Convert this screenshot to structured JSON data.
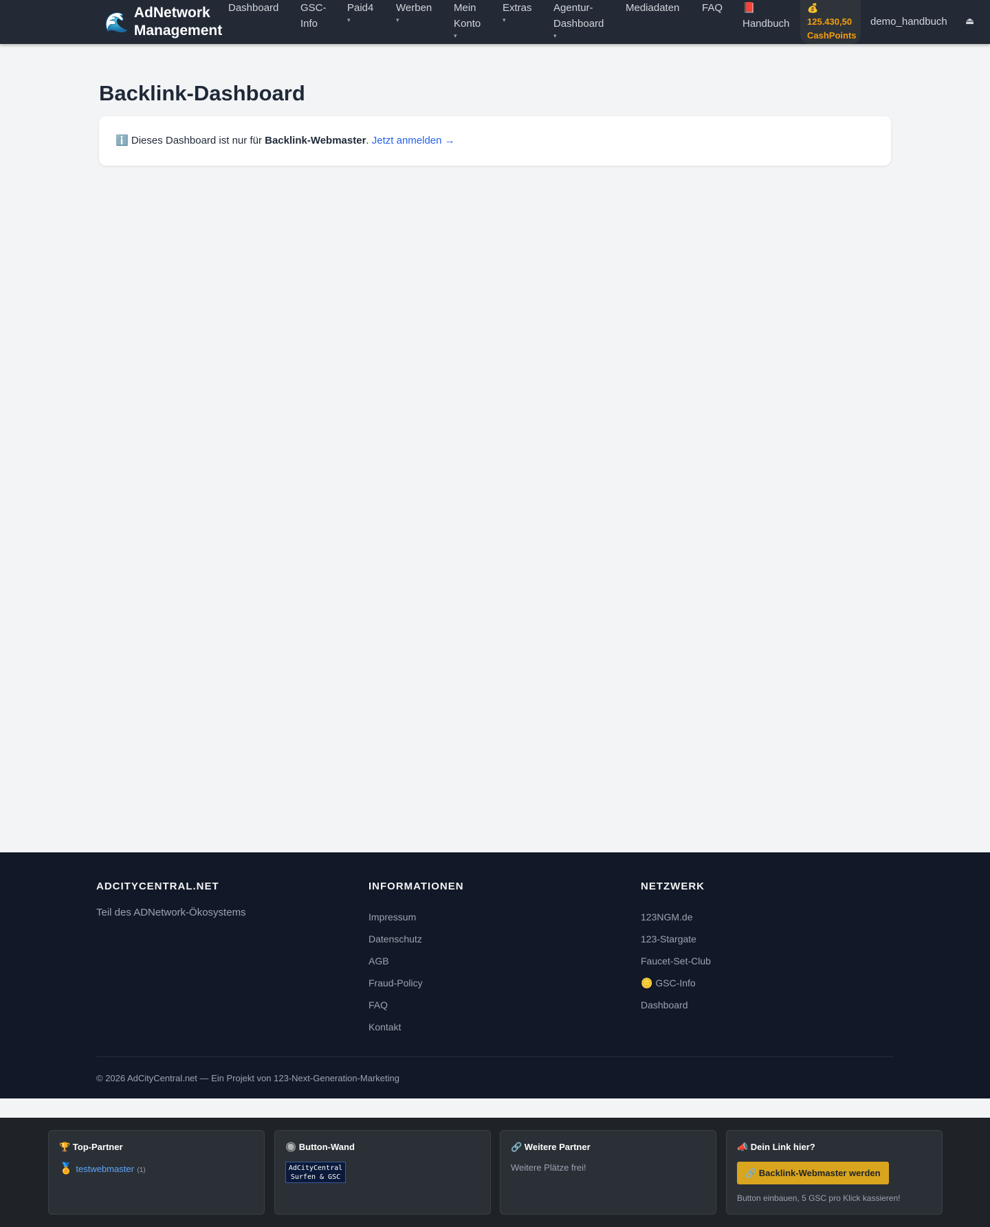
{
  "navbar": {
    "brand_icon": "🌊",
    "brand_line1": "AdNetwork",
    "brand_line2": "Management",
    "items": [
      {
        "line1": "Dashboard",
        "line2": "",
        "caret": ""
      },
      {
        "line1": "GSC-",
        "line2": "Info",
        "caret": ""
      },
      {
        "line1": "Paid4",
        "line2": "",
        "caret": "▾"
      },
      {
        "line1": "Werben",
        "line2": "",
        "caret": "▾"
      },
      {
        "line1": "Mein",
        "line2": "Konto",
        "caret": "▾"
      },
      {
        "line1": "Extras",
        "line2": "",
        "caret": "▾"
      },
      {
        "line1": "Agentur-",
        "line2": "Dashboard",
        "caret": "▾"
      },
      {
        "line1": "Mediadaten",
        "line2": "",
        "caret": ""
      },
      {
        "line1": "FAQ",
        "line2": "",
        "caret": ""
      }
    ],
    "handbuch_icon": "📕",
    "handbuch_label": "Handbuch",
    "cash_icon": "💰",
    "cash_amount": "125.430,50",
    "cash_unit": "CashPoints",
    "username": "demo_handbuch",
    "logout_icon": "⏏"
  },
  "main": {
    "title": "Backlink-Dashboard",
    "info_icon": "ℹ️",
    "info_prefix": "Dieses Dashboard ist nur für",
    "info_bold": "Backlink-Webmaster",
    "info_suffix": ".",
    "info_link": "Jetzt anmelden →"
  },
  "footer": {
    "col1_title": "ADCITYCENTRAL.NET",
    "col1_text": "Teil des ADNetwork-Ökosystems",
    "col2_title": "INFORMATIONEN",
    "col2_links": [
      "Impressum",
      "Datenschutz",
      "AGB",
      "Fraud-Policy",
      "FAQ",
      "Kontakt"
    ],
    "col3_title": "NETZWERK",
    "col3_links": [
      "123NGM.de",
      "123-Stargate",
      "Faucet-Set-Club",
      "🪙 GSC-Info",
      "Dashboard"
    ],
    "copyright": "© 2026 AdCityCentral.net — Ein Projekt von 123-Next-Generation-Marketing"
  },
  "partners": {
    "top_title": "🏆 Top-Partner",
    "top_medal": "🏅",
    "top_name": "testwebmaster",
    "top_count": "(1)",
    "wall_title": "🔘 Button-Wand",
    "wall_badge_line1": "AdCityCentral",
    "wall_badge_line2": "Surfen & GSC",
    "more_title": "🔗 Weitere Partner",
    "more_text": "Weitere Plätze frei!",
    "cta_title": "📣 Dein Link hier?",
    "cta_button": "🔗 Backlink-Webmaster werden",
    "cta_text": "Button einbauen, 5 GSC pro Klick kassieren!"
  }
}
